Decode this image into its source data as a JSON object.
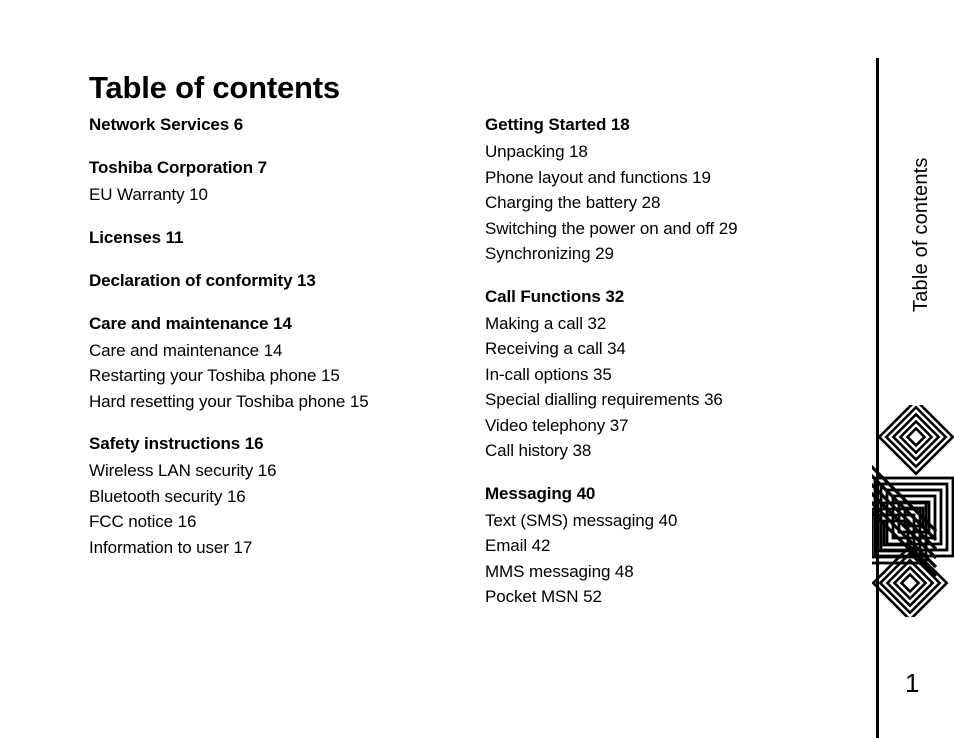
{
  "page": {
    "title": "Table of contents",
    "number": "1",
    "margin_tab_label": "Table of contents"
  },
  "decoration": {
    "name": "nested-diamonds-and-squares-motif",
    "color": "#000000"
  },
  "toc": {
    "columns": [
      {
        "id": "left",
        "groups": [
          {
            "heading": "Network Services 6",
            "entries": []
          },
          {
            "heading": "Toshiba Corporation 7",
            "entries": [
              "EU Warranty 10"
            ]
          },
          {
            "heading": "Licenses 11",
            "entries": []
          },
          {
            "heading": "Declaration of conformity 13",
            "entries": []
          },
          {
            "heading": "Care and maintenance 14",
            "entries": [
              "Care and maintenance 14",
              "Restarting your Toshiba phone 15",
              "Hard resetting your Toshiba phone 15"
            ]
          },
          {
            "heading": "Safety instructions 16",
            "entries": [
              "Wireless LAN security 16",
              "Bluetooth security 16",
              "FCC notice 16",
              "Information to user 17"
            ]
          }
        ]
      },
      {
        "id": "right",
        "groups": [
          {
            "heading": "Getting Started 18",
            "entries": [
              "Unpacking 18",
              "Phone layout and functions 19",
              "Charging the battery 28",
              "Switching the power on and off 29",
              "Synchronizing 29"
            ]
          },
          {
            "heading": "Call Functions 32",
            "entries": [
              "Making a call 32",
              "Receiving a call 34",
              "In-call options 35",
              "Special dialling requirements 36",
              "Video telephony 37",
              "Call history 38"
            ]
          },
          {
            "heading": "Messaging 40",
            "entries": [
              "Text (SMS) messaging 40",
              "Email 42",
              "MMS messaging 48",
              "Pocket MSN 52"
            ]
          }
        ]
      }
    ]
  }
}
